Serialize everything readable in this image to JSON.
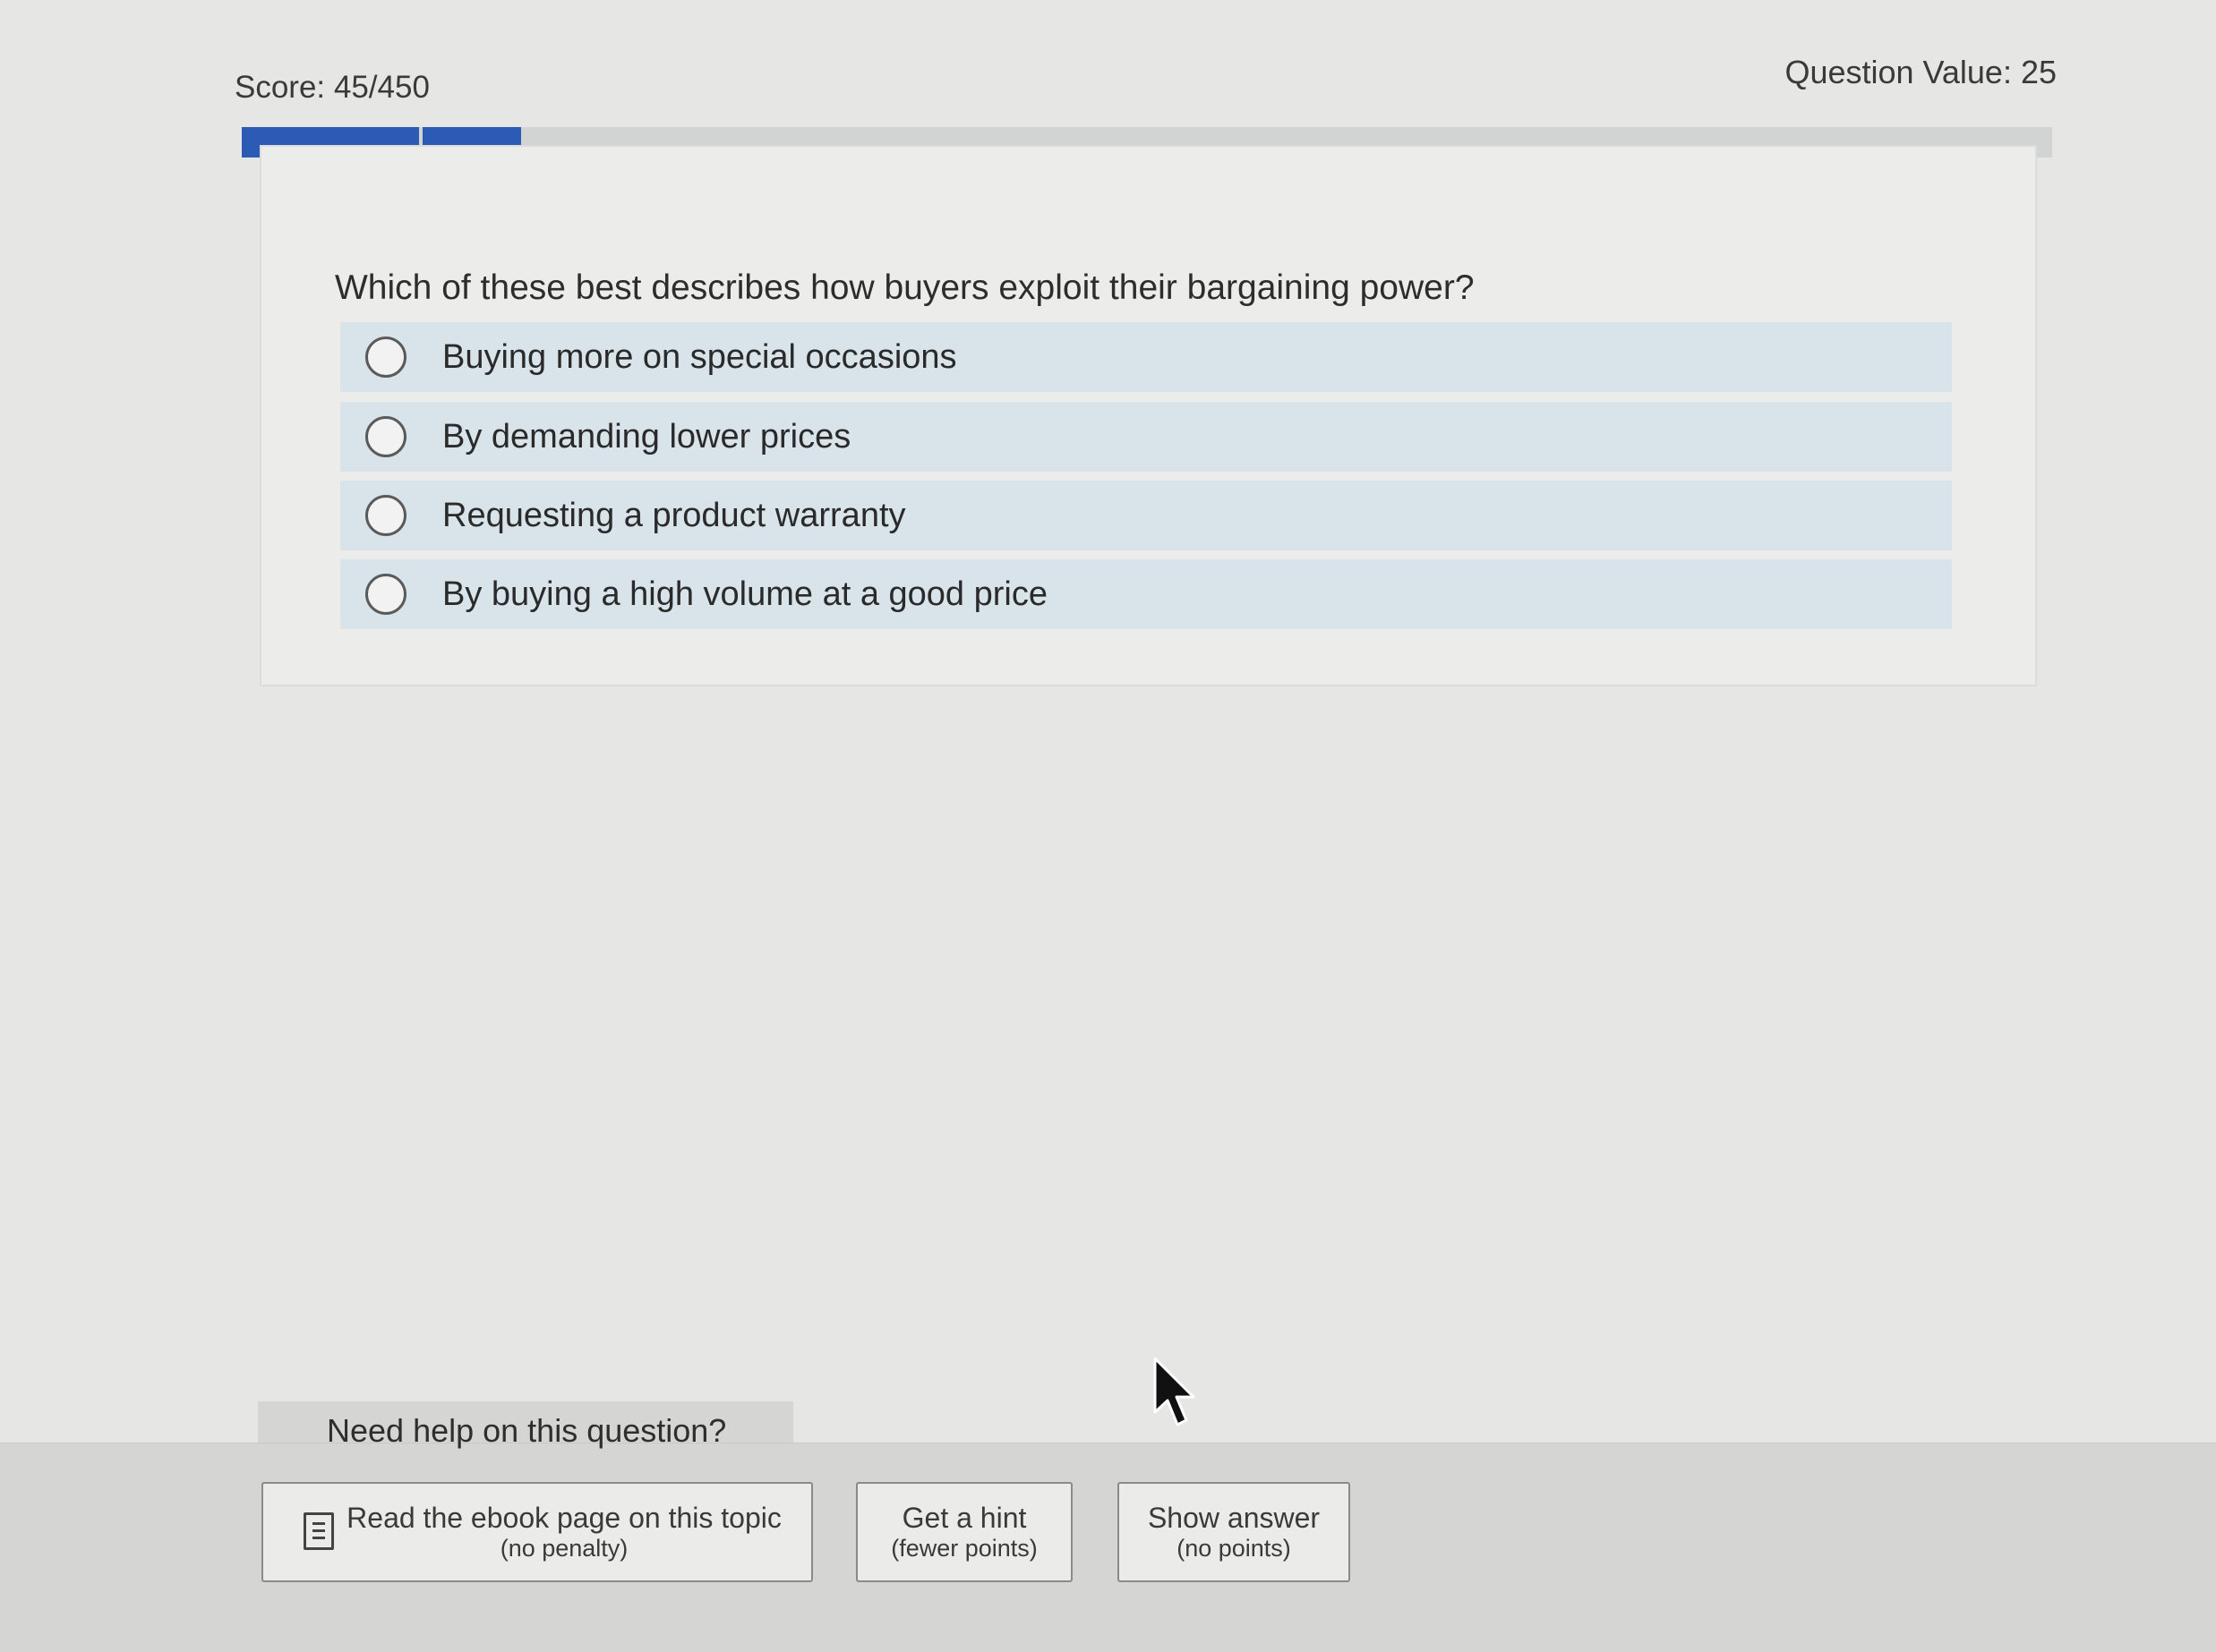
{
  "header": {
    "score": "Score: 45/450",
    "question_value": "Question Value: 25"
  },
  "progress": {
    "segments_completed": 2,
    "fraction": 0.1
  },
  "question": {
    "text": "Which of these best describes how buyers exploit their bargaining power?",
    "options": [
      {
        "label": "Buying more on special occasions",
        "selected": false
      },
      {
        "label": "By demanding lower prices",
        "selected": false
      },
      {
        "label": "Requesting a product warranty",
        "selected": false
      },
      {
        "label": "By buying a high volume at a good price",
        "selected": false
      }
    ]
  },
  "help": {
    "title": "Need help on this question?",
    "ebook": {
      "label": "Read the ebook page on this topic",
      "note": "(no penalty)"
    },
    "hint": {
      "label": "Get a hint",
      "note": "(fewer points)"
    },
    "answer": {
      "label": "Show answer",
      "note": "(no points)"
    }
  },
  "colors": {
    "progress_fill": "#2b5bb5",
    "option_background": "#d8e3ea",
    "page_background": "#e6e6e4"
  },
  "icons": {
    "ebook": "document-lines-icon",
    "radio": "radio-button-empty-icon",
    "cursor": "mouse-pointer-icon"
  }
}
